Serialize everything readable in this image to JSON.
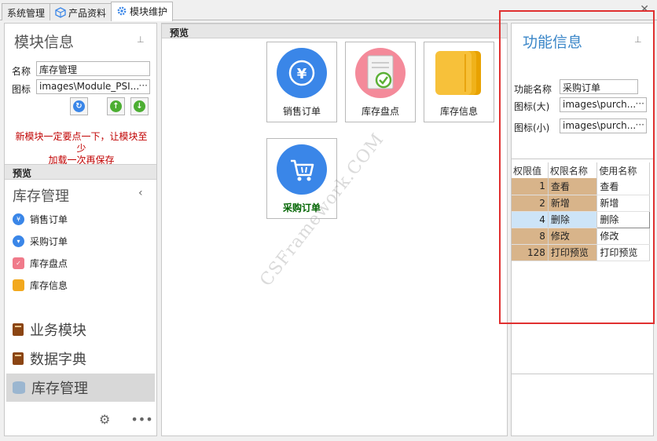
{
  "tabs": [
    {
      "label": "系统管理"
    },
    {
      "label": "产品资料"
    },
    {
      "label": "模块维护"
    }
  ],
  "left": {
    "title": "模块信息",
    "name_label": "名称",
    "name_value": "库存管理",
    "icon_label": "图标",
    "icon_value": "images\\Module_PSI...",
    "warning_line1": "新模块一定要点一下，让模块至少",
    "warning_line2": "加载一次再保存",
    "preview_label": "预览",
    "group_title": "库存管理",
    "nav_items": [
      {
        "label": "销售订单"
      },
      {
        "label": "采购订单"
      },
      {
        "label": "库存盘点"
      },
      {
        "label": "库存信息"
      }
    ],
    "modules": [
      {
        "label": "业务模块"
      },
      {
        "label": "数据字典"
      },
      {
        "label": "库存管理"
      }
    ]
  },
  "center": {
    "preview_label": "预览",
    "tiles": [
      {
        "label": "销售订单"
      },
      {
        "label": "库存盘点"
      },
      {
        "label": "库存信息"
      },
      {
        "label": "采购订单"
      }
    ],
    "watermark": "CSFramework.COM"
  },
  "right": {
    "title": "功能信息",
    "func_name_label": "功能名称",
    "func_name_value": "采购订单",
    "icon_large_label": "图标(大)",
    "icon_large_value": "images\\purch...",
    "icon_small_label": "图标(小)",
    "icon_small_value": "images\\purch...",
    "grid_headers": [
      "权限值",
      "权限名称",
      "使用名称"
    ],
    "grid_rows": [
      {
        "value": "1",
        "name": "查看",
        "use": "查看"
      },
      {
        "value": "2",
        "name": "新增",
        "use": "新增"
      },
      {
        "value": "4",
        "name": "删除",
        "use": "删除"
      },
      {
        "value": "8",
        "name": "修改",
        "use": "修改"
      },
      {
        "value": "128",
        "name": "打印预览",
        "use": "打印预览"
      }
    ]
  },
  "colors": {
    "accent_blue": "#3a86e8",
    "warning_red": "#c00000",
    "highlight_red_box": "#e03030",
    "grid_tan": "#d8b48a",
    "green_label": "#006400"
  }
}
